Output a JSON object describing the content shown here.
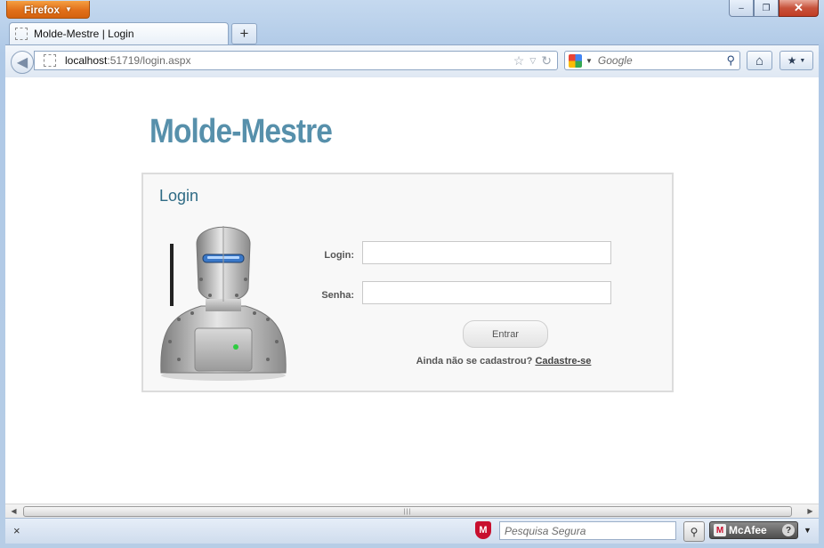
{
  "browser": {
    "menu_button": "Firefox",
    "window_controls": {
      "minimize": "‒",
      "restore": "❐",
      "close": "✕"
    },
    "tab": {
      "title": "Molde-Mestre | Login"
    },
    "new_tab_label": "+",
    "address": {
      "host": "localhost",
      "path": ":51719/login.aspx"
    },
    "search": {
      "engine": "Google",
      "placeholder": "Google"
    }
  },
  "page": {
    "logo_text": "Molde-Mestre",
    "box_title": "Login",
    "login_label": "Login:",
    "login_value": "",
    "password_label": "Senha:",
    "password_value": "",
    "submit_label": "Entrar",
    "signup_prompt": "Ainda não se cadastrou?",
    "signup_link": "Cadastre-se"
  },
  "addon_bar": {
    "close_label": "×",
    "secure_search_placeholder": "Pesquisa Segura",
    "mcafee_label": "McAfee"
  },
  "colors": {
    "logo": "#5790ab",
    "box_title": "#2f6b85",
    "firefox_button": "#e1701a"
  }
}
